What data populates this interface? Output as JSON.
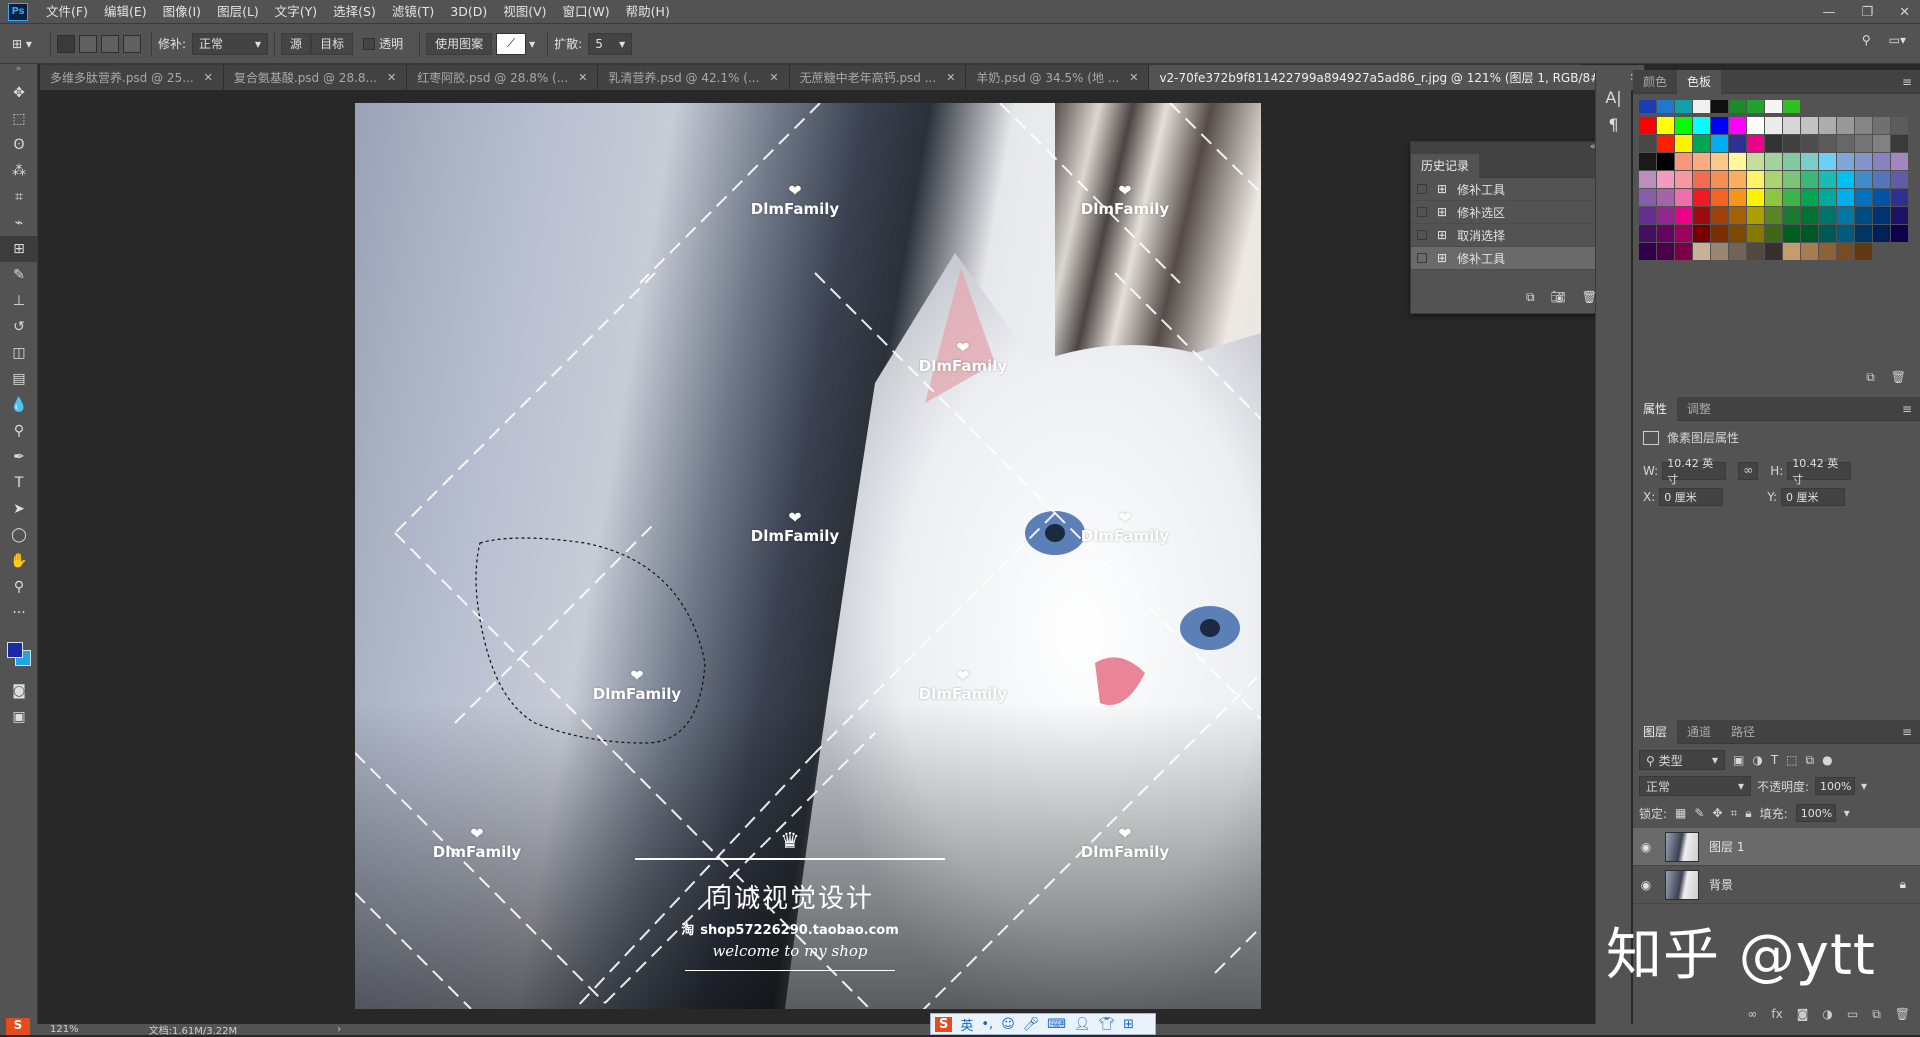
{
  "app": {
    "logo": "Ps",
    "menus": [
      "文件(F)",
      "编辑(E)",
      "图像(I)",
      "图层(L)",
      "文字(Y)",
      "选择(S)",
      "滤镜(T)",
      "3D(D)",
      "视图(V)",
      "窗口(W)",
      "帮助(H)"
    ],
    "win_controls": [
      "—",
      "❐",
      "✕"
    ]
  },
  "options": {
    "patch_label": "修补:",
    "patch_mode": "正常",
    "source": "源",
    "target": "目标",
    "transparent": "透明",
    "use_pattern": "使用图案",
    "diffuse_label": "扩散:",
    "diffuse_value": "5"
  },
  "tabs": [
    {
      "label": "多维多肽营养.psd @ 25...",
      "active": false
    },
    {
      "label": "复合氨基酸.psd @ 28.8...",
      "active": false
    },
    {
      "label": "红枣阿胶.psd @ 28.8% (...",
      "active": false
    },
    {
      "label": "乳清营养.psd @ 42.1% (...",
      "active": false
    },
    {
      "label": "无蔗糖中老年高钙.psd ...",
      "active": false
    },
    {
      "label": "羊奶.psd @ 34.5% (地 ...",
      "active": false
    },
    {
      "label": "v2-70fe372b9f811422799a894927a5ad86_r.jpg @ 121% (图层 1, RGB/8#) *",
      "active": true
    }
  ],
  "tools": [
    "move-icon",
    "marquee-icon",
    "lasso-icon",
    "quick-select-icon",
    "crop-icon",
    "eyedropper-icon",
    "patch-icon",
    "brush-icon",
    "stamp-icon",
    "history-brush-icon",
    "eraser-icon",
    "gradient-icon",
    "blur-icon",
    "dodge-icon",
    "pen-icon",
    "type-icon",
    "path-select-icon",
    "ellipse-icon",
    "hand-icon",
    "zoom-icon",
    "more-icon"
  ],
  "tool_glyphs": [
    "✥",
    "⬚",
    "ʘ",
    "⁂",
    "⌗",
    "⌁",
    "⊞",
    "✎",
    "⊥",
    "↺",
    "◫",
    "▤",
    "💧",
    "⚲",
    "✒",
    "T",
    "➤",
    "◯",
    "✋",
    "⚲",
    "···"
  ],
  "canvas": {
    "watermarks": [
      {
        "text": "DlmFamily"
      },
      {
        "text": "DlmFamily"
      },
      {
        "text": "DlmFamily"
      },
      {
        "text": "DlmFamily"
      },
      {
        "text": "DlmFamily"
      },
      {
        "text": "DlmFamily"
      },
      {
        "text": "DlmFamily"
      },
      {
        "text": "DlmFamily"
      },
      {
        "text": "DlmFamily"
      }
    ],
    "shop_title": "同诚视觉设计",
    "shop_url": "shop57226290.taobao.com",
    "shop_slogan": "welcome to my shop",
    "shop_badge": "淘"
  },
  "history": {
    "title": "历史记录",
    "items": [
      "修补工具",
      "修补选区",
      "取消选择",
      "修补工具"
    ],
    "active_index": 3
  },
  "colors_panel": {
    "tabs": [
      "颜色",
      "色板"
    ],
    "active": "色板",
    "top_row": [
      "#1b3db5",
      "#1e78d0",
      "#10a0a8",
      "#f0f0f0",
      "#101010",
      "#1a8a2a",
      "#22a030",
      "#f5f5f5",
      "#2fbf20"
    ],
    "rows": [
      [
        "#ff0000",
        "#ffff00",
        "#00ff00",
        "#00ffff",
        "#0000ff",
        "#ff00ff",
        "#ffffff",
        "#ebebeb",
        "#d6d6d6",
        "#c2c2c2",
        "#adadad",
        "#999999",
        "#858585",
        "#707070",
        "#5c5c5c"
      ],
      [
        "#474747",
        "#ff2000",
        "#fff200",
        "#00a651",
        "#00aeef",
        "#2e3192",
        "#ec008c",
        "#333333",
        "#404040",
        "#4d4d4d",
        "#5a5a5a",
        "#676767",
        "#747474",
        "#818181",
        "#3a3a3a"
      ],
      [
        "#1a1a1a",
        "#000000",
        "#f7977a",
        "#f9ad81",
        "#fdc68a",
        "#fff79a",
        "#c4df9b",
        "#a2d39c",
        "#82ca9d",
        "#7bcdc8",
        "#6ecff6",
        "#7ea7d8",
        "#8493ca",
        "#8882be",
        "#a187be"
      ],
      [
        "#bc8dbf",
        "#f49ac2",
        "#f6989d",
        "#f26c4f",
        "#f68e55",
        "#fbaf5c",
        "#fff467",
        "#acd372",
        "#7cc576",
        "#3bb878",
        "#1abbb4",
        "#00bff3",
        "#438cca",
        "#5574b9",
        "#605ca8"
      ],
      [
        "#855fa8",
        "#a763a8",
        "#f06ea9",
        "#ed1c24",
        "#f26522",
        "#f7941d",
        "#fff200",
        "#8dc73f",
        "#39b54a",
        "#00a651",
        "#00a99d",
        "#00aeef",
        "#0072bc",
        "#0054a6",
        "#2e3192"
      ],
      [
        "#662d91",
        "#92278f",
        "#ec008c",
        "#9e0b0f",
        "#a0410d",
        "#a36209",
        "#aba000",
        "#598527",
        "#1a7b30",
        "#007236",
        "#00746b",
        "#0076a3",
        "#004b80",
        "#003471",
        "#1b1464"
      ],
      [
        "#440e62",
        "#630460",
        "#9e005d",
        "#790000",
        "#7b2e00",
        "#7d4900",
        "#827b00",
        "#406618",
        "#005e20",
        "#005826",
        "#005952",
        "#005b7f",
        "#003663",
        "#002157",
        "#0d004c"
      ],
      [
        "#32004b",
        "#4b0049",
        "#7b0046",
        "#c7b299",
        "#998675",
        "#736357",
        "#534741",
        "#37302d",
        "#c69c6d",
        "#a67c52",
        "#8c6239",
        "#754c24",
        "#603913",
        "#",
        ""
      ]
    ]
  },
  "properties": {
    "tabs": [
      "属性",
      "调整"
    ],
    "header": "像素图层属性",
    "w_label": "W:",
    "w": "10.42 英寸",
    "h_label": "H:",
    "h": "10.42 英寸",
    "x_label": "X:",
    "x": "0 厘米",
    "y_label": "Y:",
    "y": "0 厘米"
  },
  "layers": {
    "tabs": [
      "图层",
      "通道",
      "路径"
    ],
    "filter": "类型",
    "blend": "正常",
    "opacity_label": "不透明度:",
    "opacity": "100%",
    "lock_label": "锁定:",
    "fill_label": "填充:",
    "fill": "100%",
    "items": [
      {
        "name": "图层 1",
        "active": true,
        "locked": false
      },
      {
        "name": "背景",
        "active": false,
        "locked": true
      }
    ]
  },
  "status": {
    "zoom": "121%",
    "doc": "文档:1.61M/3.22M"
  },
  "ime": {
    "lang": "英"
  },
  "overlay": {
    "watermark": "知乎 @ytt"
  }
}
